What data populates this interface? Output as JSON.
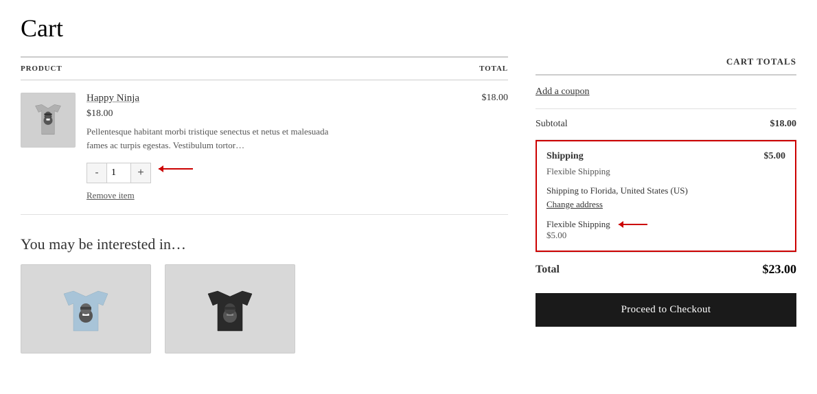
{
  "page": {
    "title": "Cart"
  },
  "table": {
    "col_product": "PRODUCT",
    "col_total": "TOTAL"
  },
  "product": {
    "name": "Happy Ninja",
    "price": "$18.00",
    "description": "Pellentesque habitant morbi tristique senectus et netus et malesuada fames ac turpis egestas. Vestibulum tortor…",
    "quantity": "1",
    "total": "$18.00",
    "remove_label": "Remove item"
  },
  "cart_totals": {
    "title": "CART TOTALS",
    "coupon_label": "Add a coupon",
    "subtotal_label": "Subtotal",
    "subtotal_value": "$18.00",
    "shipping_label": "Shipping",
    "shipping_value": "$5.00",
    "shipping_method": "Flexible Shipping",
    "shipping_to": "Shipping to Florida, United States (US)",
    "change_address": "Change address",
    "flexible_shipping_name": "Flexible Shipping",
    "flexible_shipping_price": "$5.00",
    "total_label": "Total",
    "total_value": "$23.00",
    "checkout_label": "Proceed to Checkout"
  },
  "you_may": {
    "heading": "You may be interested in…"
  },
  "colors": {
    "border_red": "#cc0000",
    "button_dark": "#1a1a1a"
  }
}
